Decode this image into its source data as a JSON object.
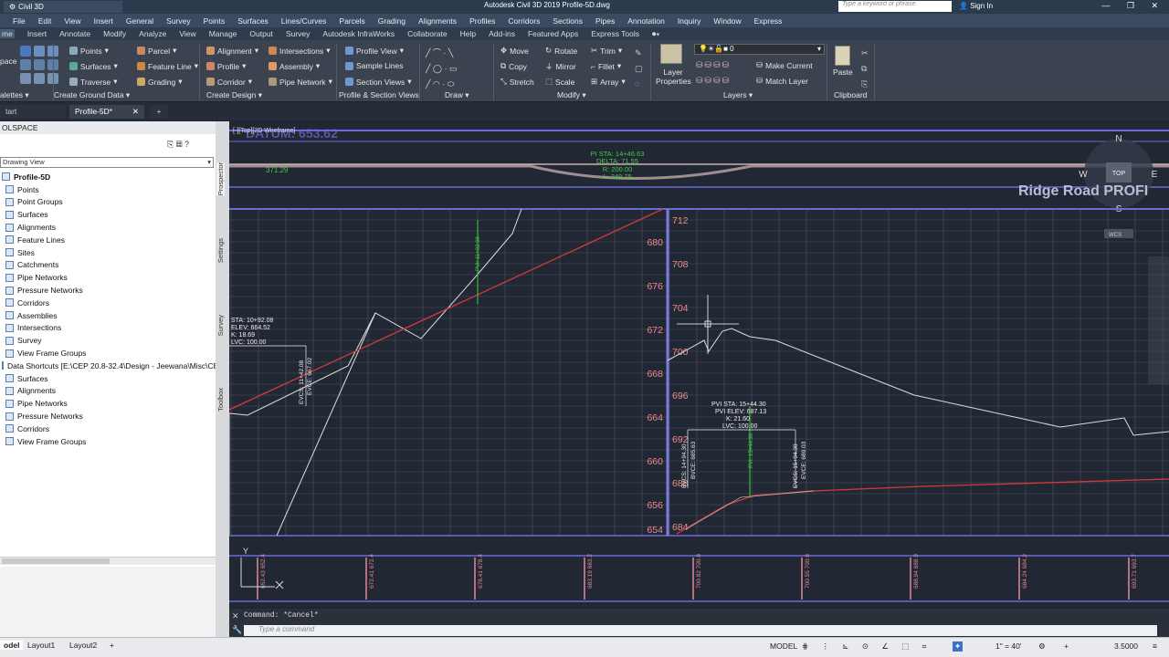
{
  "title_bar": {
    "workspace": "Civil 3D",
    "app_title": "Autodesk Civil 3D 2019   Profile-5D.dwg",
    "search_placeholder": "Type a keyword or phrase",
    "sign_in": "Sign In"
  },
  "menu": [
    "File",
    "Edit",
    "View",
    "Insert",
    "General",
    "Survey",
    "Points",
    "Surfaces",
    "Lines/Curves",
    "Parcels",
    "Grading",
    "Alignments",
    "Profiles",
    "Corridors",
    "Sections",
    "Pipes",
    "Annotation",
    "Inquiry",
    "Window",
    "Express"
  ],
  "ribbon_tabs": [
    "me",
    "Insert",
    "Annotate",
    "Modify",
    "Analyze",
    "View",
    "Manage",
    "Output",
    "Survey",
    "Autodesk InfraWorks",
    "Collaborate",
    "Help",
    "Add-ins",
    "Featured Apps",
    "Express Tools"
  ],
  "ribbon": {
    "toolspace_label": "pace",
    "palettes_panel": "alettes",
    "ground": {
      "items": [
        "Points",
        "Surfaces",
        "Traverse",
        "Parcel",
        "Feature Line",
        "Grading"
      ],
      "title": "Create Ground Data"
    },
    "design": {
      "items": [
        "Alignment",
        "Profile",
        "Corridor",
        "Intersections",
        "Assembly",
        "Pipe Network"
      ],
      "title": "Create Design"
    },
    "profile_views": {
      "items": [
        "Profile View",
        "Sample Lines",
        "Section Views"
      ],
      "title": "Profile & Section Views"
    },
    "draw": {
      "title": "Draw"
    },
    "modify": {
      "items": [
        "Move",
        "Rotate",
        "Trim",
        "Copy",
        "Mirror",
        "Fillet",
        "Stretch",
        "Scale",
        "Array"
      ],
      "title": "Modify"
    },
    "layers": {
      "layer_properties": "Layer Properties",
      "layer_value": "0",
      "make_current": "Make Current",
      "match_layer": "Match Layer",
      "title": "Layers"
    },
    "clipboard": {
      "paste": "Paste",
      "title": "Clipboard"
    }
  },
  "doc_tabs": {
    "start": "tart",
    "active": "Profile-5D*"
  },
  "palette": {
    "header": "OLSPACE",
    "view_dropdown": "Drawing View",
    "tree": [
      "Profile-5D",
      "Points",
      "Point Groups",
      "Surfaces",
      "Alignments",
      "Feature Lines",
      "Sites",
      "Catchments",
      "Pipe Networks",
      "Pressure Networks",
      "Corridors",
      "Assemblies",
      "Intersections",
      "Survey",
      "View Frame Groups",
      "Data Shortcuts [E:\\CEP 20.8-32.4\\Design - Jeewana\\Misc\\CE...",
      "Surfaces",
      "Alignments",
      "Pipe Networks",
      "Pressure Networks",
      "Corridors",
      "View Frame Groups"
    ],
    "side_tabs": [
      "Prospector",
      "Settings",
      "Survey",
      "Toolbox"
    ]
  },
  "drawing": {
    "viewport_label": "[-][Top][2D Wireframe]",
    "datum": "DATUM: 653.62",
    "plan_label": "371.29",
    "pi_label": [
      "PI STA: 14+46.63",
      "DELTA: 71.55",
      "R: 200.00",
      "L: 249.75"
    ],
    "viewcube": {
      "n": "N",
      "s": "S",
      "w": "W",
      "e": "E",
      "top": "TOP",
      "wcs": "WCS"
    },
    "profile_title": "Ridge Road PROFI",
    "left_axis": [
      "680",
      "676",
      "672",
      "668",
      "664",
      "660",
      "656",
      "654"
    ],
    "right_axis": [
      "712",
      "708",
      "704",
      "700",
      "696",
      "692",
      "688",
      "684"
    ],
    "vc1": [
      "STA: 10+92.08",
      "ELEV: 664.52",
      "K: 18.69",
      "LVC: 100.00"
    ],
    "vc1_ticks": [
      "EVCS: 11+42.08",
      "EVCE: 667.02"
    ],
    "vc2": [
      "PVI STA: 15+44.30",
      "PVI ELEV: 687.13",
      "K: 21.60",
      "LVC: 100.00"
    ],
    "vc2_ticks": [
      "BVCS: 14+94.30",
      "BVCE: 685.63",
      "EVCS: 15+94.30",
      "EVCE: 689.03"
    ],
    "green_label_1": "PVI: 11+92.08",
    "green_label_2": "PVI: 15+44.30",
    "band_values": [
      "652.43\n652.4",
      "672.41\n672.4",
      "678.41\n678.4",
      "683.19\n683.2",
      "700.82\n700.8",
      "700.55\n700.6",
      "688.94\n688.9",
      "684.24\n684.2",
      "693.71\n693.7"
    ]
  },
  "command": {
    "history": "Command: *Cancel*",
    "placeholder": "Type a command"
  },
  "status": {
    "model_tab": "odel",
    "layouts": [
      "Layout1",
      "Layout2"
    ],
    "model": "MODEL",
    "scale": "1\" = 40'",
    "value": "3.5000"
  }
}
